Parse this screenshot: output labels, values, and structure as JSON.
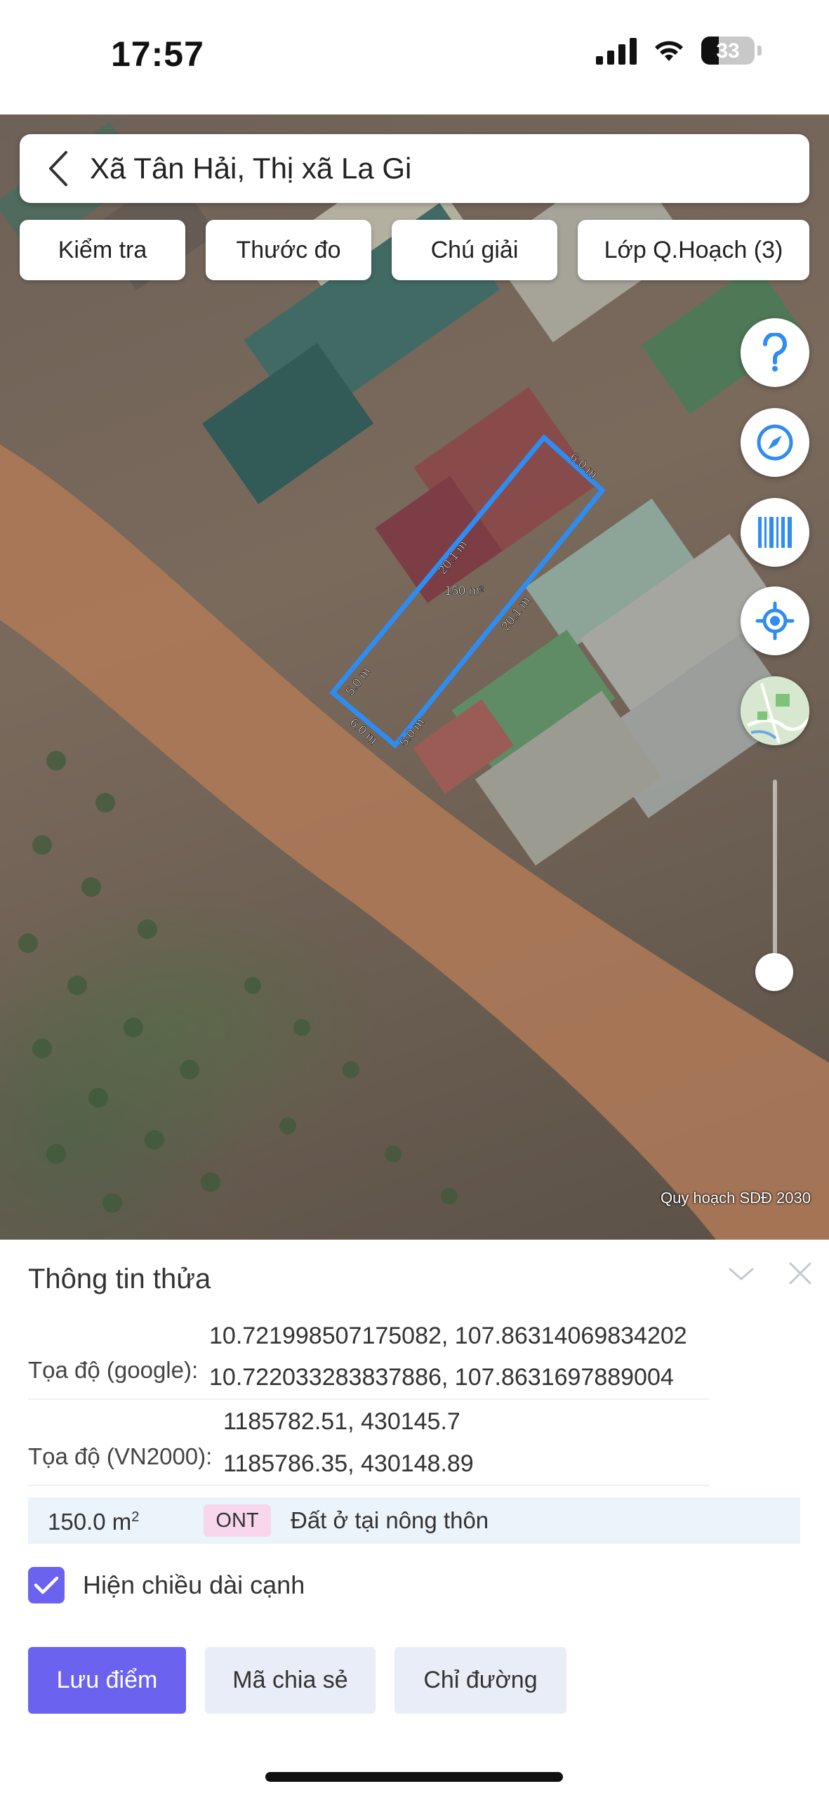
{
  "status_bar": {
    "time": "17:57",
    "battery": "33",
    "battery_level": 0.33
  },
  "search": {
    "text": "Xã Tân Hải, Thị xã La Gi"
  },
  "toolbar": {
    "check": "Kiểm tra",
    "ruler": "Thước đo",
    "legend": "Chú giải",
    "layers": "Lớp Q.Hoạch (3)"
  },
  "map": {
    "edges": {
      "top_short": "6.0 m",
      "long_upper": "20.1 m",
      "long_lower": "20.1 m",
      "left_short": "5.0 m",
      "bottom_left": "6.0 m",
      "bottom_right": "5.0 m"
    },
    "area_label": "150 m²",
    "credit": "Quy hoạch SDĐ 2030",
    "parcel_color": "#2f8cf0",
    "zoom_slider_level": 0.0
  },
  "fab_icons": [
    "question-icon",
    "compass-icon",
    "barcode-icon",
    "locate-icon",
    "map-thumbnail-icon"
  ],
  "panel": {
    "title": "Thông tin thửa",
    "google_label": "Tọa độ (google):",
    "google_1": "10.721998507175082, 107.86314069834202",
    "google_2": "10.722033283837886, 107.8631697889004",
    "vn2000_label": "Tọa độ (VN2000):",
    "vn2000_1": "1185782.51, 430145.7",
    "vn2000_2": "1185786.35, 430148.89",
    "area_value": "150.0 m",
    "area_unit_sup": "2",
    "land_code": "ONT",
    "land_name": "Đất ở tại nông thôn",
    "show_edge_length": "Hiện chiều dài cạnh",
    "show_edge_checked": true
  },
  "actions": {
    "save": "Lưu điểm",
    "share": "Mã chia sẻ",
    "directions": "Chỉ đường"
  },
  "colors": {
    "accent": "#6b62f0",
    "info_bg": "#ebf3fb",
    "code_bg": "#f8d6ec",
    "fab_blue": "#2f8cf0"
  }
}
